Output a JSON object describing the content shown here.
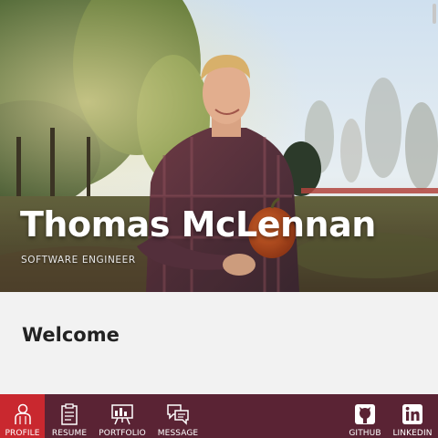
{
  "hero": {
    "name": "Thomas McLennan",
    "subtitle": "SOFTWARE ENGINEER"
  },
  "main": {
    "heading": "Welcome"
  },
  "nav": {
    "items": [
      {
        "label": "PROFILE",
        "icon": "person-icon",
        "active": true
      },
      {
        "label": "RESUME",
        "icon": "clipboard-icon",
        "active": false
      },
      {
        "label": "PORTFOLIO",
        "icon": "presentation-board-icon",
        "active": false
      },
      {
        "label": "MESSAGE",
        "icon": "chat-bubbles-icon",
        "active": false
      },
      {
        "label": "GITHUB",
        "icon": "github-icon",
        "active": false
      },
      {
        "label": "LINKEDIN",
        "icon": "linkedin-icon",
        "active": false
      }
    ]
  },
  "colors": {
    "nav_background": "#5a2334",
    "nav_active": "#c9282f",
    "content_background": "#f2f2f2",
    "heading_text": "#222222"
  }
}
